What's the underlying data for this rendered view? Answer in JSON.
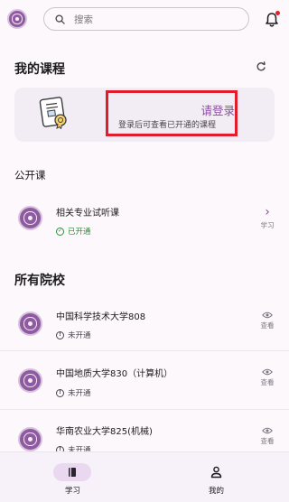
{
  "search": {
    "placeholder": "搜索"
  },
  "my_courses": {
    "title": "我的课程"
  },
  "login_card": {
    "title": "请登录",
    "subtitle": "登录后可查看已开通的课程"
  },
  "public_courses": {
    "title": "公开课",
    "items": [
      {
        "name": "相关专业试听课",
        "status": "已开通",
        "action": "学习"
      }
    ]
  },
  "all_schools": {
    "title": "所有院校",
    "items": [
      {
        "name": "中国科学技术大学808",
        "status": "未开通",
        "action": "查看"
      },
      {
        "name": "中国地质大学830（计算机）",
        "status": "未开通",
        "action": "查看"
      },
      {
        "name": "华南农业大学825(机械)",
        "status": "未开通",
        "action": "查看"
      }
    ]
  },
  "bottom_nav": {
    "items": [
      {
        "label": "学习",
        "icon": "book-icon",
        "active": true
      },
      {
        "label": "我的",
        "icon": "person-icon",
        "active": false
      }
    ]
  },
  "colors": {
    "accent": "#8e4aa8",
    "highlight": "#e11d2b",
    "open": "#2f8f3a",
    "notification": "#e0202a"
  }
}
